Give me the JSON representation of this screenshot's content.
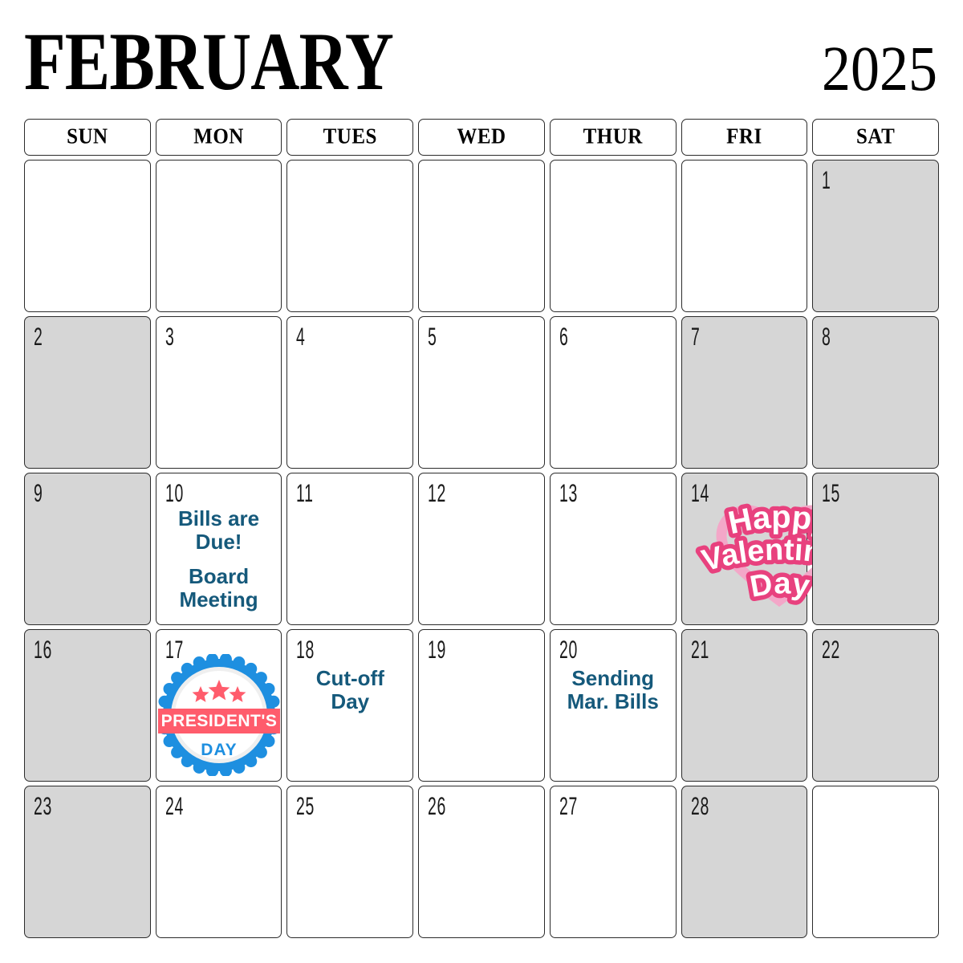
{
  "header": {
    "month": "FEBRUARY",
    "year": "2025"
  },
  "weekdays": [
    {
      "label": "SUN"
    },
    {
      "label": "MON"
    },
    {
      "label": "TUES"
    },
    {
      "label": "WED"
    },
    {
      "label": "THUR"
    },
    {
      "label": "FRI"
    },
    {
      "label": "SAT"
    }
  ],
  "colors": {
    "event_text": "#15597b",
    "shaded_cell": "#d6d6d6",
    "cell_border": "#2b2b2b",
    "valentine_heart": "#f3a7c8",
    "valentine_outline": "#e8417e",
    "presidents_blue": "#1e8fe0",
    "presidents_red": "#ff5c6c"
  },
  "weeks": [
    {
      "days": [
        {
          "number": "",
          "shaded": false,
          "events": [],
          "graphic": ""
        },
        {
          "number": "",
          "shaded": false,
          "events": [],
          "graphic": ""
        },
        {
          "number": "",
          "shaded": false,
          "events": [],
          "graphic": ""
        },
        {
          "number": "",
          "shaded": false,
          "events": [],
          "graphic": ""
        },
        {
          "number": "",
          "shaded": false,
          "events": [],
          "graphic": ""
        },
        {
          "number": "",
          "shaded": false,
          "events": [],
          "graphic": ""
        },
        {
          "number": "1",
          "shaded": true,
          "events": [],
          "graphic": ""
        }
      ]
    },
    {
      "days": [
        {
          "number": "2",
          "shaded": true,
          "events": [],
          "graphic": ""
        },
        {
          "number": "3",
          "shaded": false,
          "events": [],
          "graphic": ""
        },
        {
          "number": "4",
          "shaded": false,
          "events": [],
          "graphic": ""
        },
        {
          "number": "5",
          "shaded": false,
          "events": [],
          "graphic": ""
        },
        {
          "number": "6",
          "shaded": false,
          "events": [],
          "graphic": ""
        },
        {
          "number": "7",
          "shaded": true,
          "events": [],
          "graphic": ""
        },
        {
          "number": "8",
          "shaded": true,
          "events": [],
          "graphic": ""
        }
      ]
    },
    {
      "days": [
        {
          "number": "9",
          "shaded": true,
          "events": [],
          "graphic": ""
        },
        {
          "number": "10",
          "shaded": false,
          "events": [
            "Bills are\nDue!",
            "Board\nMeeting"
          ],
          "graphic": ""
        },
        {
          "number": "11",
          "shaded": false,
          "events": [],
          "graphic": ""
        },
        {
          "number": "12",
          "shaded": false,
          "events": [],
          "graphic": ""
        },
        {
          "number": "13",
          "shaded": false,
          "events": [],
          "graphic": ""
        },
        {
          "number": "14",
          "shaded": true,
          "events": [],
          "graphic": "valentines-day-graphic"
        },
        {
          "number": "15",
          "shaded": true,
          "events": [],
          "graphic": ""
        }
      ]
    },
    {
      "days": [
        {
          "number": "16",
          "shaded": true,
          "events": [],
          "graphic": ""
        },
        {
          "number": "17",
          "shaded": false,
          "events": [],
          "graphic": "presidents-day-badge"
        },
        {
          "number": "18",
          "shaded": false,
          "events": [
            "Cut-off\nDay"
          ],
          "graphic": ""
        },
        {
          "number": "19",
          "shaded": false,
          "events": [],
          "graphic": ""
        },
        {
          "number": "20",
          "shaded": false,
          "events": [
            "Sending\nMar. Bills"
          ],
          "graphic": ""
        },
        {
          "number": "21",
          "shaded": true,
          "events": [],
          "graphic": ""
        },
        {
          "number": "22",
          "shaded": true,
          "events": [],
          "graphic": ""
        }
      ]
    },
    {
      "days": [
        {
          "number": "23",
          "shaded": true,
          "events": [],
          "graphic": ""
        },
        {
          "number": "24",
          "shaded": false,
          "events": [],
          "graphic": ""
        },
        {
          "number": "25",
          "shaded": false,
          "events": [],
          "graphic": ""
        },
        {
          "number": "26",
          "shaded": false,
          "events": [],
          "graphic": ""
        },
        {
          "number": "27",
          "shaded": false,
          "events": [],
          "graphic": ""
        },
        {
          "number": "28",
          "shaded": true,
          "events": [],
          "graphic": ""
        },
        {
          "number": "",
          "shaded": false,
          "events": [],
          "graphic": ""
        }
      ]
    }
  ],
  "graphics": {
    "valentines": {
      "line1": "Happy",
      "line2": "Valentines",
      "line3": "Day"
    },
    "presidents": {
      "banner": "PRESIDENT'S",
      "sub": "DAY",
      "stars": 3
    }
  }
}
